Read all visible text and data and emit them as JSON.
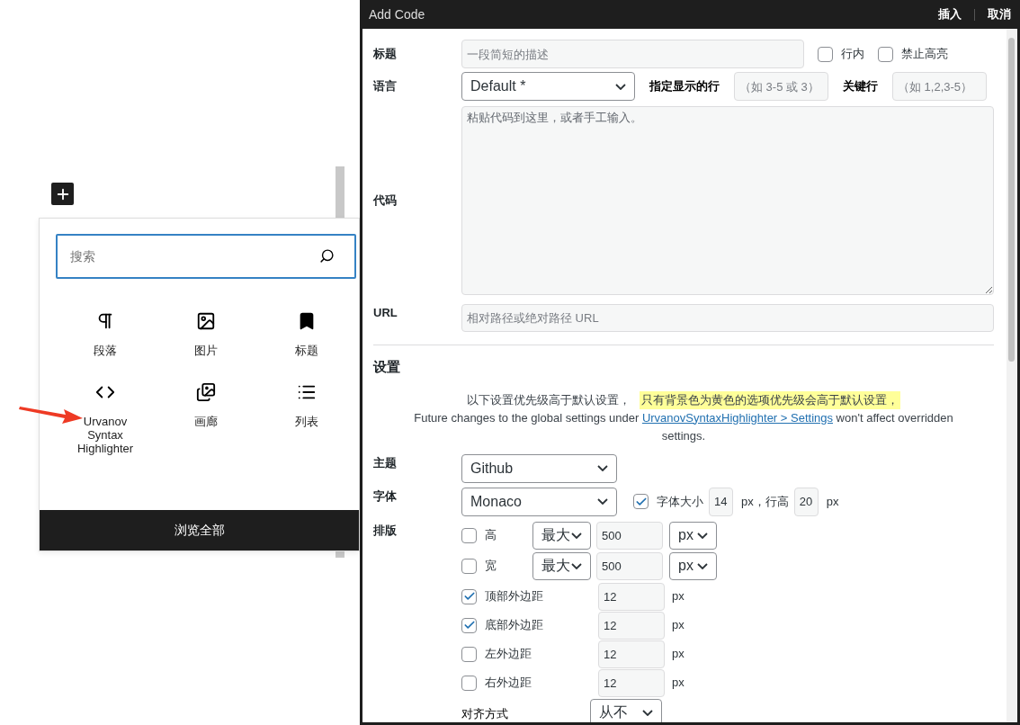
{
  "inserter": {
    "search": {
      "placeholder": "搜索"
    },
    "blocks": [
      {
        "kind": "paragraph",
        "label": "段落"
      },
      {
        "kind": "image",
        "label": "图片"
      },
      {
        "kind": "heading",
        "label": "标题"
      },
      {
        "kind": "code",
        "label": "Urvanov Syntax Highlighter"
      },
      {
        "kind": "gallery",
        "label": "画廊"
      },
      {
        "kind": "list",
        "label": "列表"
      }
    ],
    "browse_all": "浏览全部"
  },
  "dialog": {
    "title": "Add Code",
    "actions": [
      "插入",
      "取消"
    ],
    "title_row": {
      "label": "标题",
      "placeholder": "一段简短的描述",
      "options": [
        {
          "label": "行内",
          "checked": false
        },
        {
          "label": "禁止高亮",
          "checked": false
        }
      ]
    },
    "language_row": {
      "label": "语言",
      "value": "Default *",
      "lines_label": "指定显示的行",
      "lines_placeholder": "（如 3-5 或 3）",
      "marked_label": "关键行",
      "marked_placeholder": "（如 1,2,3-5）"
    },
    "code_row": {
      "label": "代码",
      "placeholder": "粘贴代码到这里，或者手工输入。"
    },
    "url_row": {
      "label": "URL",
      "placeholder": "相对路径或绝对路径 URL"
    },
    "settings": {
      "heading": "设置",
      "notice": "以下设置优先级高于默认设置，",
      "highlight": "只有背景色为黄色的选项优先级会高于默认设置，",
      "note_prefix": "Future changes to the global settings under ",
      "note_link": "UrvanovSyntaxHighlighter > Settings",
      "note_suffix": " won't affect overridden settings."
    },
    "theme_row": {
      "label": "主题",
      "value": "Github"
    },
    "font_row": {
      "label": "字体",
      "value": "Monaco",
      "size_checked": true,
      "size_label": "字体大小",
      "size_value": "14",
      "size_unit": "px，行高",
      "line_height_value": "20",
      "line_height_unit": "px"
    },
    "layout": {
      "label": "排版",
      "rows": [
        {
          "kind": "dimension",
          "label": "高",
          "checked": false,
          "mode": "最大",
          "value": "500",
          "unit": "px"
        },
        {
          "kind": "dimension",
          "label": "宽",
          "checked": false,
          "mode": "最大",
          "value": "500",
          "unit": "px"
        },
        {
          "kind": "margin",
          "label": "顶部外边距",
          "checked": true,
          "value": "12",
          "unit": "px"
        },
        {
          "kind": "margin",
          "label": "底部外边距",
          "checked": true,
          "value": "12",
          "unit": "px"
        },
        {
          "kind": "margin",
          "label": "左外边距",
          "checked": false,
          "value": "12",
          "unit": "px"
        },
        {
          "kind": "margin",
          "label": "右外边距",
          "checked": false,
          "value": "12",
          "unit": "px"
        }
      ]
    },
    "align_row": {
      "label": "对齐方式",
      "value": "从不"
    }
  }
}
